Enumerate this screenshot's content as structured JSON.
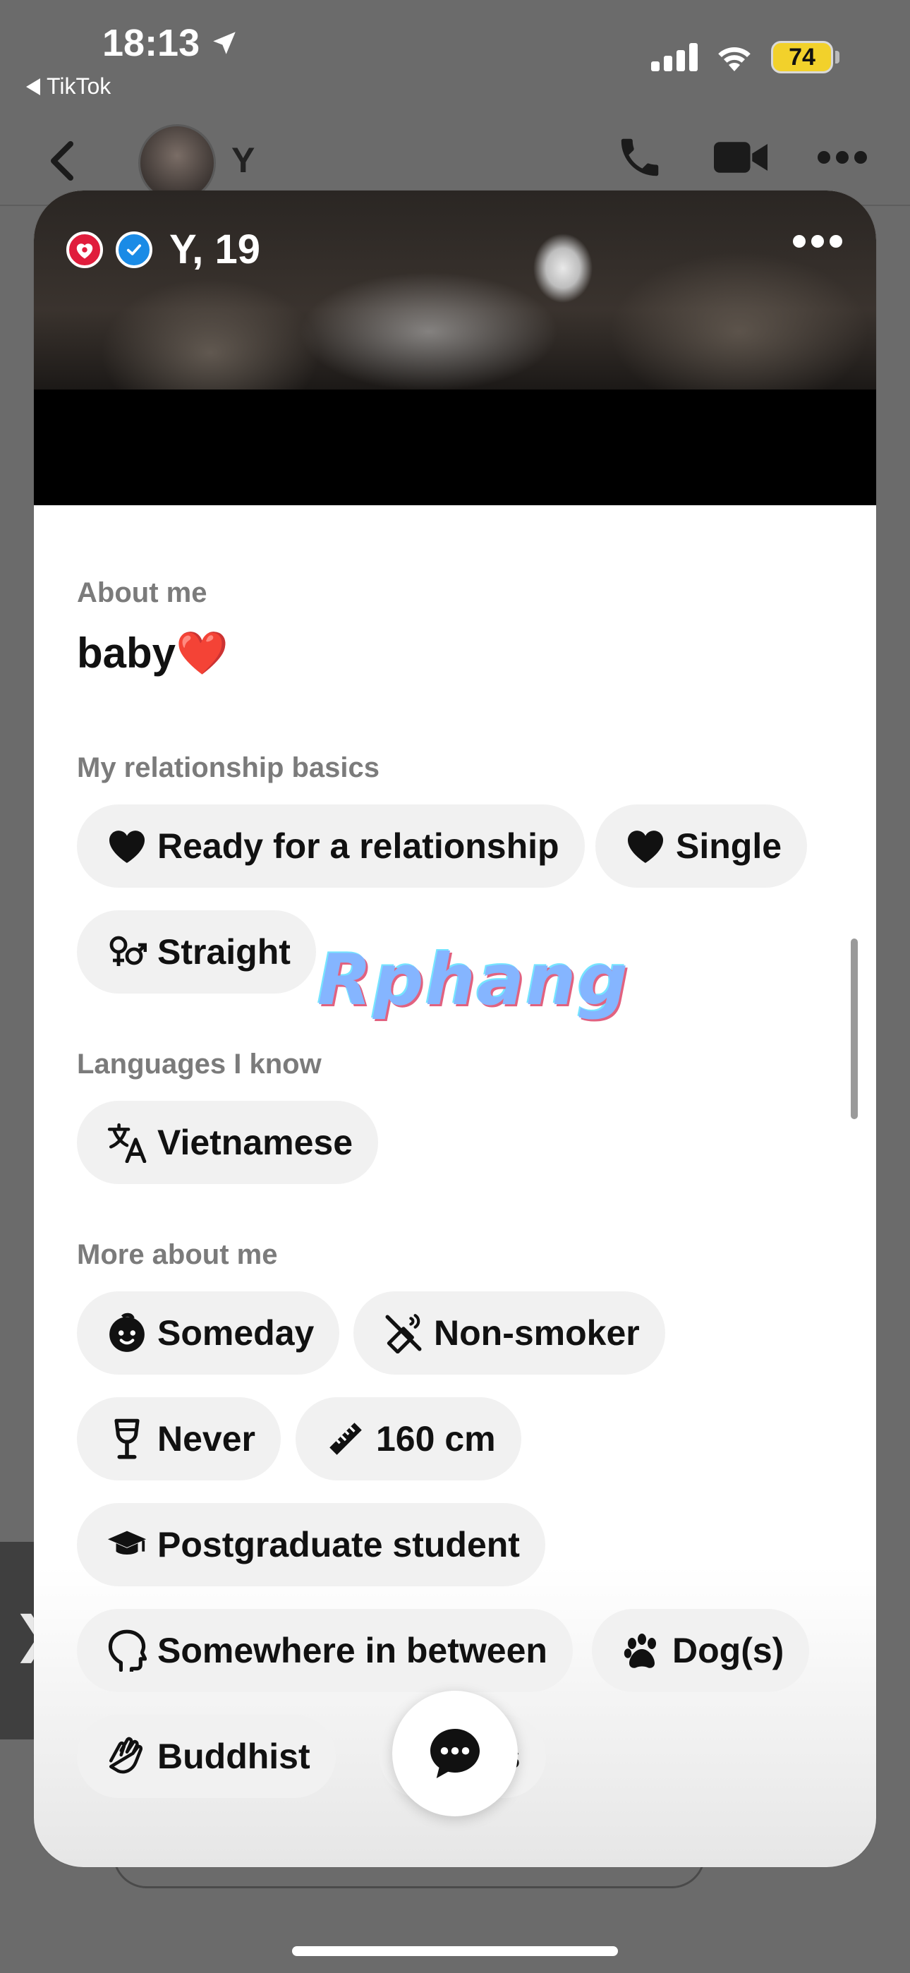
{
  "status_bar": {
    "time": "18:13",
    "back_app": "TikTok",
    "battery": "74",
    "icons": [
      "location-arrow-icon",
      "cellular-signal-icon",
      "wifi-icon",
      "battery-icon"
    ]
  },
  "chat_header": {
    "name": "Y",
    "icons": [
      "back-chevron-icon",
      "phone-icon",
      "video-camera-icon",
      "more-dots-icon"
    ]
  },
  "profile": {
    "name_age": "Y, 19",
    "badges": [
      "hearts-badge-icon",
      "verified-check-icon"
    ],
    "about_label": "About me",
    "about_text": "baby❤️",
    "relationship_label": "My relationship basics",
    "relationship_chips": [
      {
        "icon": "heart-icon",
        "label": "Ready for a relationship"
      },
      {
        "icon": "heart-icon",
        "label": "Single"
      },
      {
        "icon": "gender-symbols-icon",
        "label": "Straight"
      }
    ],
    "languages_label": "Languages I know",
    "language_chips": [
      {
        "icon": "translate-icon",
        "label": "Vietnamese"
      }
    ],
    "more_label": "More about me",
    "more_chips": [
      {
        "icon": "baby-face-icon",
        "label": "Someday"
      },
      {
        "icon": "no-smoking-icon",
        "label": "Non-smoker"
      },
      {
        "icon": "wine-glass-icon",
        "label": "Never"
      },
      {
        "icon": "ruler-icon",
        "label": "160 cm"
      },
      {
        "icon": "graduation-cap-icon",
        "label": "Postgraduate student"
      },
      {
        "icon": "head-profile-icon",
        "label": "Somewhere in between"
      },
      {
        "icon": "paw-icon",
        "label": "Dog(s)"
      },
      {
        "icon": "praying-hands-icon",
        "label": "Buddhist"
      },
      {
        "icon": "zodiac-icon",
        "label": "rius"
      }
    ]
  },
  "watermark": "Rphang",
  "colors": {
    "badge_red": "#e01d3c",
    "badge_blue": "#1a8be6",
    "battery_yellow": "#f2d12b",
    "chip_bg": "#f1f1f1"
  }
}
